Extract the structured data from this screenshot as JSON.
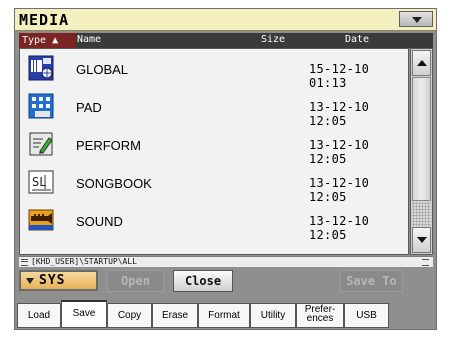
{
  "window": {
    "title": "MEDIA"
  },
  "columns": {
    "type": "Type ▲",
    "name": "Name",
    "size": "Size",
    "date": "Date"
  },
  "files": [
    {
      "name": "GLOBAL",
      "date": "15-12-10 01:13",
      "icon": "global-icon"
    },
    {
      "name": "PAD",
      "date": "13-12-10 12:05",
      "icon": "pad-icon"
    },
    {
      "name": "PERFORM",
      "date": "13-12-10 12:05",
      "icon": "perform-icon"
    },
    {
      "name": "SONGBOOK",
      "date": "13-12-10 12:05",
      "icon": "songbook-icon"
    },
    {
      "name": "SOUND",
      "date": "13-12-10 12:05",
      "icon": "sound-icon"
    }
  ],
  "path": "[KHD_USER]\\STARTUP\\ALL",
  "device": {
    "label": "SYS"
  },
  "buttons": {
    "open": "Open",
    "close": "Close",
    "save_to": "Save To"
  },
  "tabs": [
    {
      "label": "Load",
      "active": false
    },
    {
      "label": "Save",
      "active": true
    },
    {
      "label": "Copy",
      "active": false
    },
    {
      "label": "Erase",
      "active": false
    },
    {
      "label": "Format",
      "active": false
    },
    {
      "label": "Utility",
      "active": false
    },
    {
      "label": "Prefer-\nences",
      "active": false
    },
    {
      "label": "USB",
      "active": false
    }
  ],
  "colors": {
    "title_bg": "#f3efbf",
    "type_header": "#7c2323",
    "device_button": "#e6b25a",
    "panel": "#8f8f8f"
  }
}
